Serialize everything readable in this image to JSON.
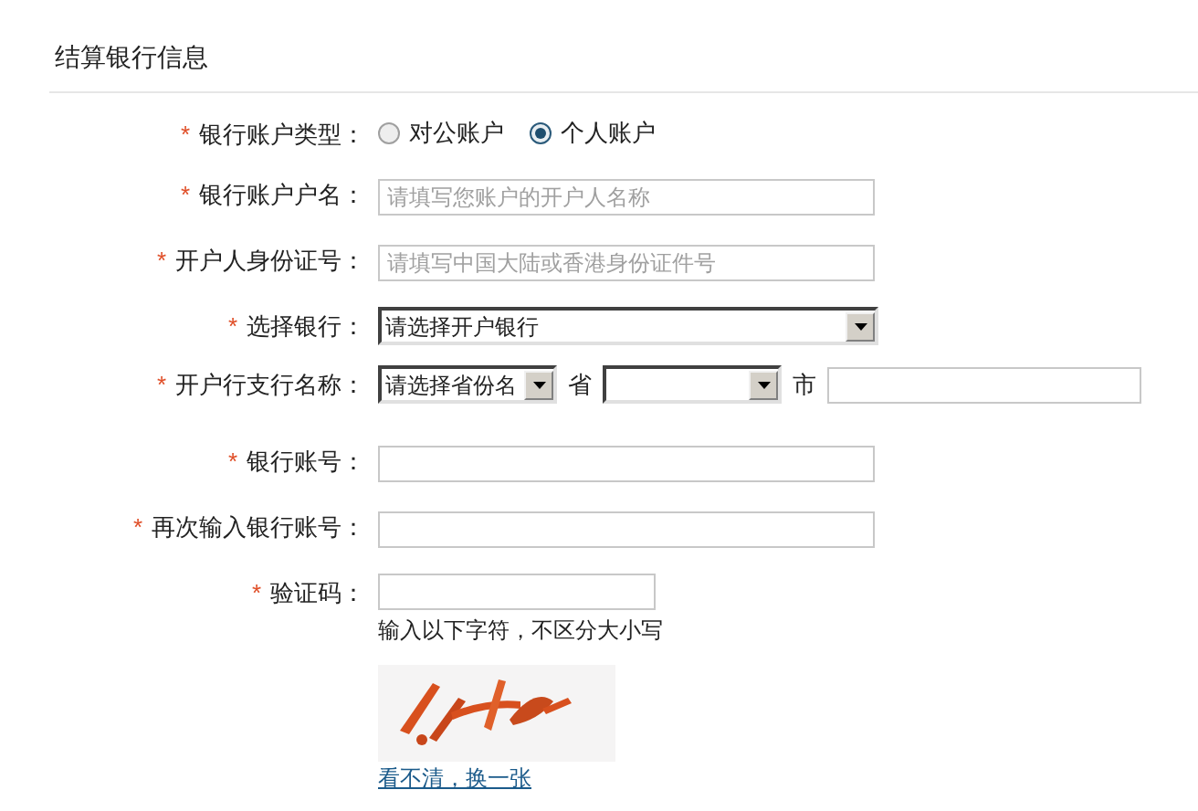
{
  "section_title": "结算银行信息",
  "fields": [
    {
      "kind": "radio",
      "required": true,
      "label": "银行账户类型：",
      "options": [
        {
          "label": "对公账户",
          "selected": false
        },
        {
          "label": "个人账户",
          "selected": true
        }
      ]
    },
    {
      "kind": "text",
      "required": true,
      "label": "银行账户户名：",
      "placeholder": "请填写您账户的开户人名称"
    },
    {
      "kind": "text",
      "required": true,
      "label": "开户人身份证号：",
      "placeholder": "请填写中国大陆或香港身份证件号"
    },
    {
      "kind": "select",
      "required": true,
      "label": "选择银行：",
      "value": "请选择开户银行"
    },
    {
      "kind": "branch",
      "required": true,
      "label": "开户行支行名称：",
      "province_value": "请选择省份名",
      "province_unit": "省",
      "city_unit": "市"
    },
    {
      "kind": "text",
      "required": true,
      "label": "银行账号："
    },
    {
      "kind": "text",
      "required": true,
      "label": "再次输入银行账号："
    },
    {
      "kind": "captcha",
      "required": true,
      "label": "验证码：",
      "hint": "输入以下字符，不区分大小写",
      "refresh_link": "看不清，换一张"
    }
  ],
  "required_mark": "*"
}
